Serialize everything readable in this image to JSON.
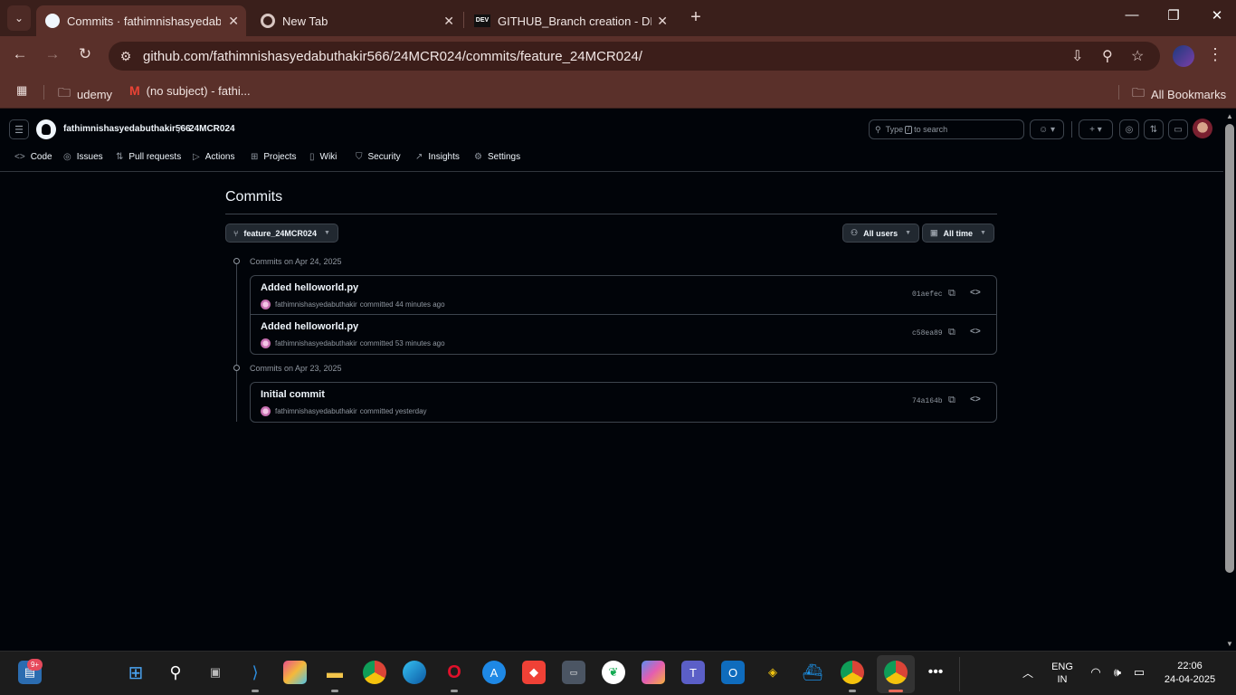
{
  "browser": {
    "tabs": [
      {
        "title": "Commits · fathimnishasyedabut",
        "active": true,
        "icon": "github-icon"
      },
      {
        "title": "New Tab",
        "active": false,
        "icon": "chrome-icon"
      },
      {
        "title": "GITHUB_Branch creation - DEV",
        "active": false,
        "icon": "dev-icon",
        "icon_text": "DEV"
      }
    ],
    "url": "github.com/fathimnishasyedabuthakir566/24MCR024/commits/feature_24MCR024/",
    "bookmarks": [
      {
        "label": "udemy",
        "icon": "folder-icon"
      },
      {
        "label": "(no subject) - fathi...",
        "icon": "gmail-icon"
      }
    ],
    "all_bookmarks": "All Bookmarks"
  },
  "github": {
    "owner": "fathimnishasyedabuthakir566",
    "repo": "24MCR024",
    "search_placeholder_pre": "Type",
    "search_kbd": "/",
    "search_placeholder_post": "to search",
    "nav": [
      {
        "label": "Code",
        "icon": "code-icon"
      },
      {
        "label": "Issues",
        "icon": "issue-icon"
      },
      {
        "label": "Pull requests",
        "icon": "pull-request-icon"
      },
      {
        "label": "Actions",
        "icon": "play-icon"
      },
      {
        "label": "Projects",
        "icon": "table-icon"
      },
      {
        "label": "Wiki",
        "icon": "book-icon"
      },
      {
        "label": "Security",
        "icon": "shield-icon"
      },
      {
        "label": "Insights",
        "icon": "graph-icon"
      },
      {
        "label": "Settings",
        "icon": "gear-icon"
      }
    ],
    "page_title": "Commits",
    "branch": "feature_24MCR024",
    "filter_users": "All users",
    "filter_time": "All time",
    "groups": [
      {
        "label": "Commits on Apr 24, 2025",
        "commits": [
          {
            "title": "Added helloworld.py",
            "author": "fathimnishasyedabuthakir",
            "meta": "committed 44 minutes ago",
            "sha": "01aefec"
          },
          {
            "title": "Added helloworld.py",
            "author": "fathimnishasyedabuthakir",
            "meta": "committed 53 minutes ago",
            "sha": "c58ea89"
          }
        ]
      },
      {
        "label": "Commits on Apr 23, 2025",
        "commits": [
          {
            "title": "Initial commit",
            "author": "fathimnishasyedabuthakir",
            "meta": "committed yesterday",
            "sha": "74a164b"
          }
        ]
      }
    ]
  },
  "taskbar": {
    "notification_badge": "9+",
    "lang_line1": "ENG",
    "lang_line2": "IN",
    "time": "22:06",
    "date": "24-04-2025"
  },
  "colors": {
    "chrome_frame": "#3a1f1b",
    "chrome_toolbar": "#5a302a",
    "github_bg": "#010409",
    "border": "#3d444d",
    "muted_text": "#9198a1"
  }
}
